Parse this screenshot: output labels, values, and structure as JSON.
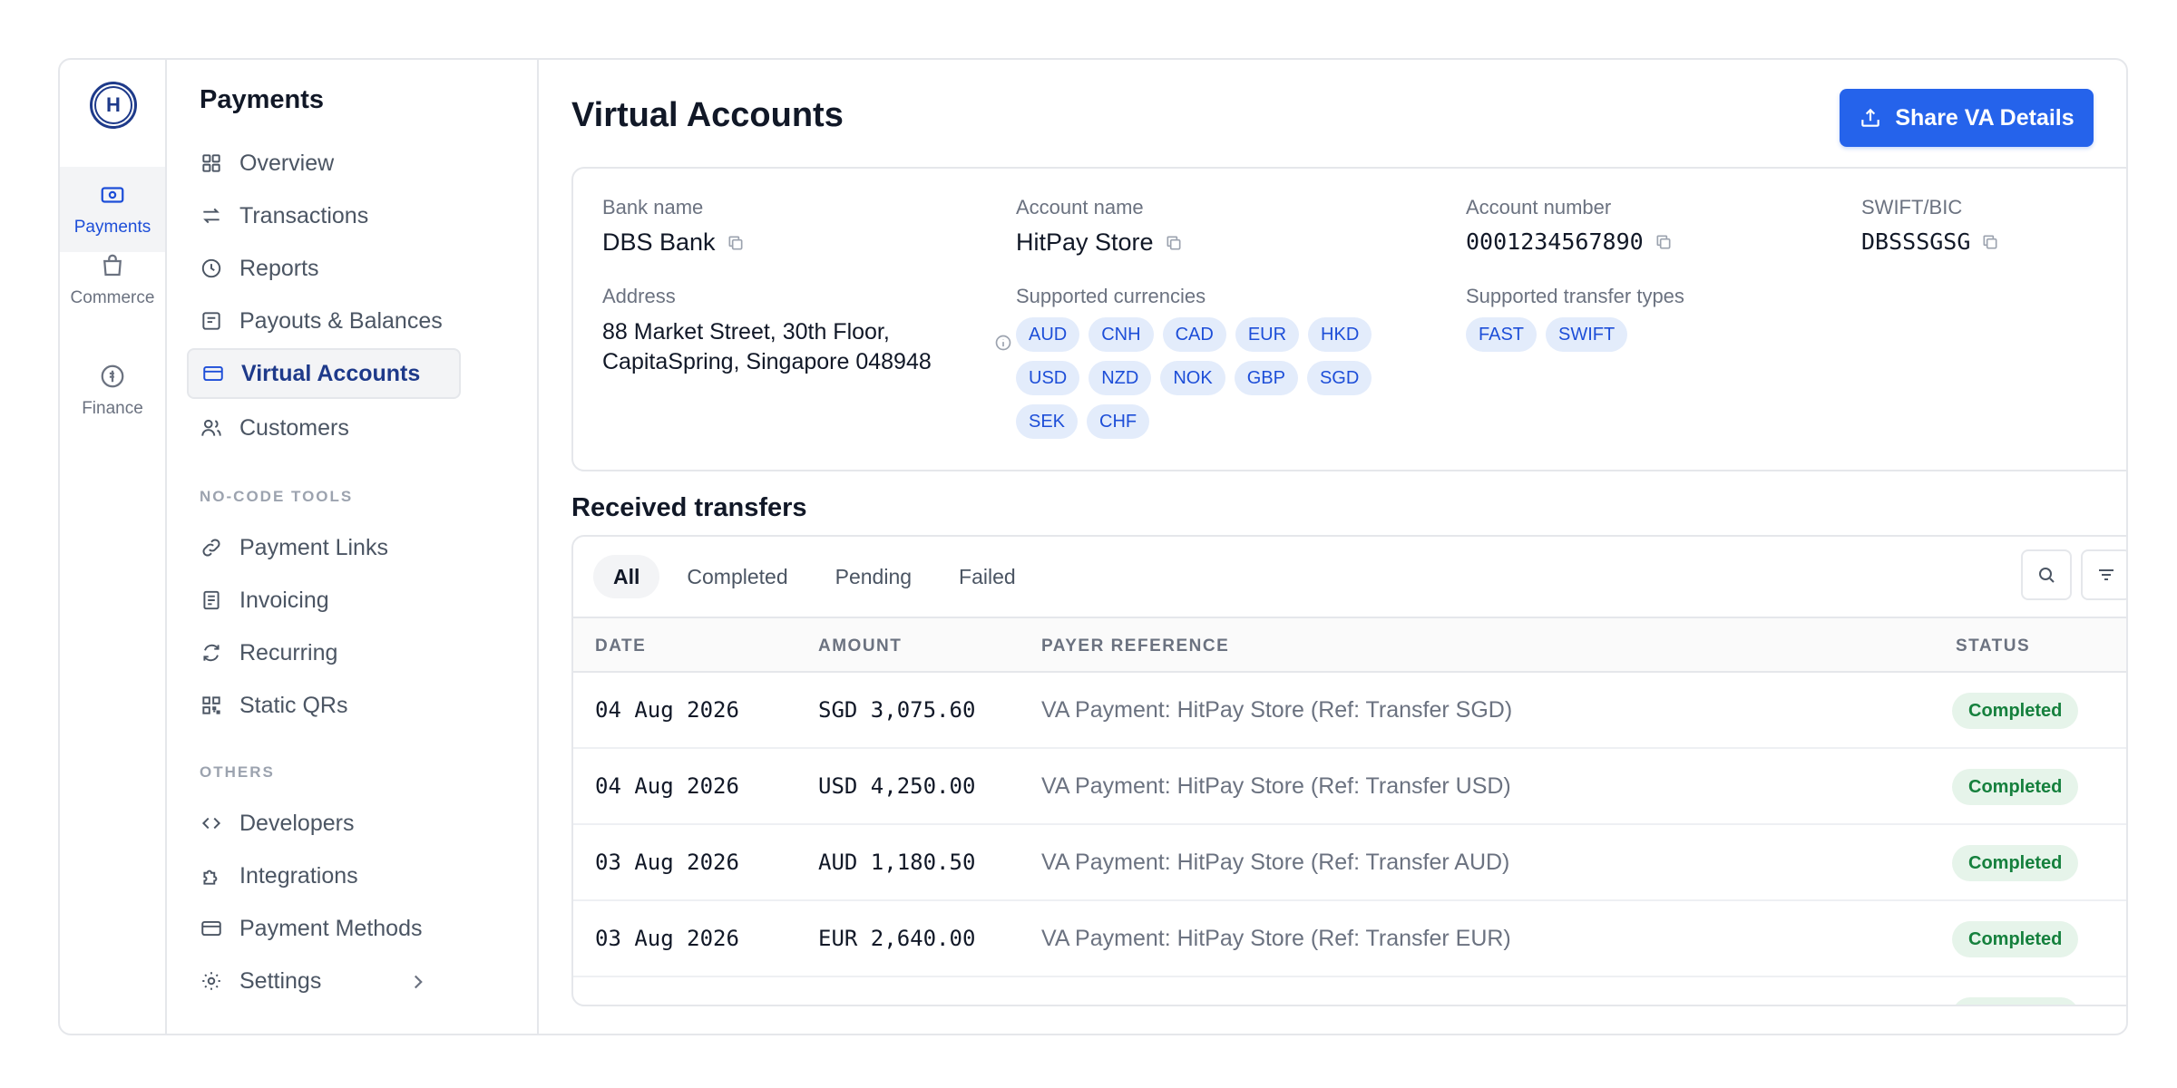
{
  "rail": {
    "logo_letter": "H",
    "items": [
      {
        "label": "Payments",
        "icon": "banknote-icon"
      },
      {
        "label": "Commerce",
        "icon": "shopping-bag-icon"
      },
      {
        "label": "Finance",
        "icon": "coin-icon"
      }
    ]
  },
  "nav": {
    "title": "Payments",
    "main_items": [
      {
        "label": "Overview",
        "icon": "grid-icon"
      },
      {
        "label": "Transactions",
        "icon": "arrows-icon"
      },
      {
        "label": "Reports",
        "icon": "clock-icon"
      },
      {
        "label": "Payouts & Balances",
        "icon": "receipt-icon"
      },
      {
        "label": "Virtual Accounts",
        "icon": "card-icon"
      },
      {
        "label": "Customers",
        "icon": "users-icon"
      }
    ],
    "section_no_code": "NO-CODE TOOLS",
    "no_code_items": [
      {
        "label": "Payment Links",
        "icon": "link-icon"
      },
      {
        "label": "Invoicing",
        "icon": "document-icon"
      },
      {
        "label": "Recurring",
        "icon": "refresh-icon"
      },
      {
        "label": "Static QRs",
        "icon": "qr-icon"
      }
    ],
    "section_others": "OTHERS",
    "other_items": [
      {
        "label": "Developers",
        "icon": "code-icon"
      },
      {
        "label": "Integrations",
        "icon": "puzzle-icon"
      },
      {
        "label": "Payment Methods",
        "icon": "card-icon"
      },
      {
        "label": "Settings",
        "icon": "gear-icon"
      }
    ]
  },
  "header": {
    "title": "Virtual Accounts",
    "share_label": "Share VA Details"
  },
  "details": {
    "bank_name_label": "Bank name",
    "bank_name": "DBS Bank",
    "account_name_label": "Account name",
    "account_name": "HitPay Store",
    "account_number_label": "Account number",
    "account_number": "0001234567890",
    "swift_label": "SWIFT/BIC",
    "swift": "DBSSSGSG",
    "address_label": "Address",
    "address": "88 Market Street, 30th Floor, CapitaSpring, Singapore 048948",
    "currencies_label": "Supported currencies",
    "currencies": [
      "AUD",
      "CNH",
      "CAD",
      "EUR",
      "HKD",
      "USD",
      "NZD",
      "NOK",
      "GBP",
      "SGD",
      "SEK",
      "CHF"
    ],
    "transfer_types_label": "Supported transfer types",
    "transfer_types": [
      "FAST",
      "SWIFT"
    ]
  },
  "transfers": {
    "title": "Received transfers",
    "tabs": [
      "All",
      "Completed",
      "Pending",
      "Failed"
    ],
    "active_tab": "All",
    "columns": {
      "date": "DATE",
      "amount": "AMOUNT",
      "reference": "PAYER REFERENCE",
      "status": "STATUS"
    },
    "rows": [
      {
        "date": "04 Aug 2026",
        "amount": "SGD 3,075.60",
        "reference": "VA Payment: HitPay Store (Ref: Transfer SGD)",
        "status": "Completed"
      },
      {
        "date": "04 Aug 2026",
        "amount": "USD 4,250.00",
        "reference": "VA Payment: HitPay Store (Ref: Transfer USD)",
        "status": "Completed"
      },
      {
        "date": "03 Aug 2026",
        "amount": "AUD 1,180.50",
        "reference": "VA Payment: HitPay Store (Ref: Transfer AUD)",
        "status": "Completed"
      },
      {
        "date": "03 Aug 2026",
        "amount": "EUR 2,640.00",
        "reference": "VA Payment: HitPay Store (Ref: Transfer EUR)",
        "status": "Completed"
      }
    ]
  },
  "colors": {
    "accent": "#2563eb",
    "nav_active": "#1e3a8a",
    "chip_bg": "#e3ecfb",
    "status_completed_bg": "#e6f4ea",
    "status_completed_text": "#15803d"
  }
}
